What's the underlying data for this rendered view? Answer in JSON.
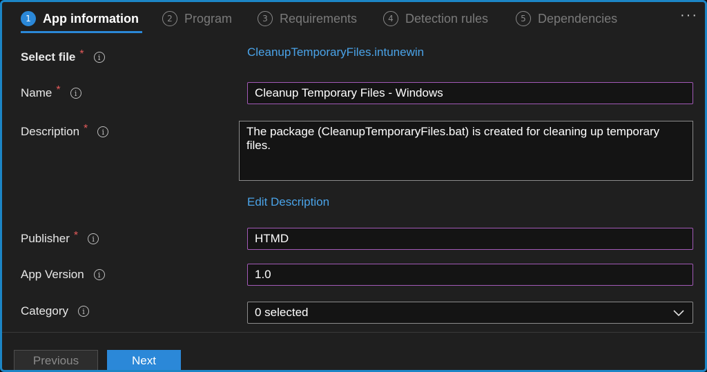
{
  "tabs": [
    {
      "num": "1",
      "label": "App information",
      "active": true
    },
    {
      "num": "2",
      "label": "Program"
    },
    {
      "num": "3",
      "label": "Requirements"
    },
    {
      "num": "4",
      "label": "Detection rules"
    },
    {
      "num": "5",
      "label": "Dependencies"
    }
  ],
  "more_label": "···",
  "form": {
    "select_file": {
      "label": "Select file",
      "required": "*",
      "value": "CleanupTemporaryFiles.intunewin"
    },
    "name": {
      "label": "Name",
      "required": "*",
      "value": "Cleanup Temporary Files - Windows"
    },
    "description": {
      "label": "Description",
      "required": "*",
      "value": "The package (CleanupTemporaryFiles.bat) is created for cleaning up temporary files.",
      "edit_link": "Edit Description"
    },
    "publisher": {
      "label": "Publisher",
      "required": "*",
      "value": "HTMD"
    },
    "app_version": {
      "label": "App Version",
      "value": "1.0"
    },
    "category": {
      "label": "Category",
      "value": "0 selected"
    }
  },
  "info_glyph": "i",
  "footer": {
    "previous_label": "Previous",
    "next_label": "Next"
  },
  "colors": {
    "accent": "#2b88d8",
    "required": "#e35a5a",
    "link": "#4aa3e8",
    "focus_border": "#a35ab8"
  }
}
